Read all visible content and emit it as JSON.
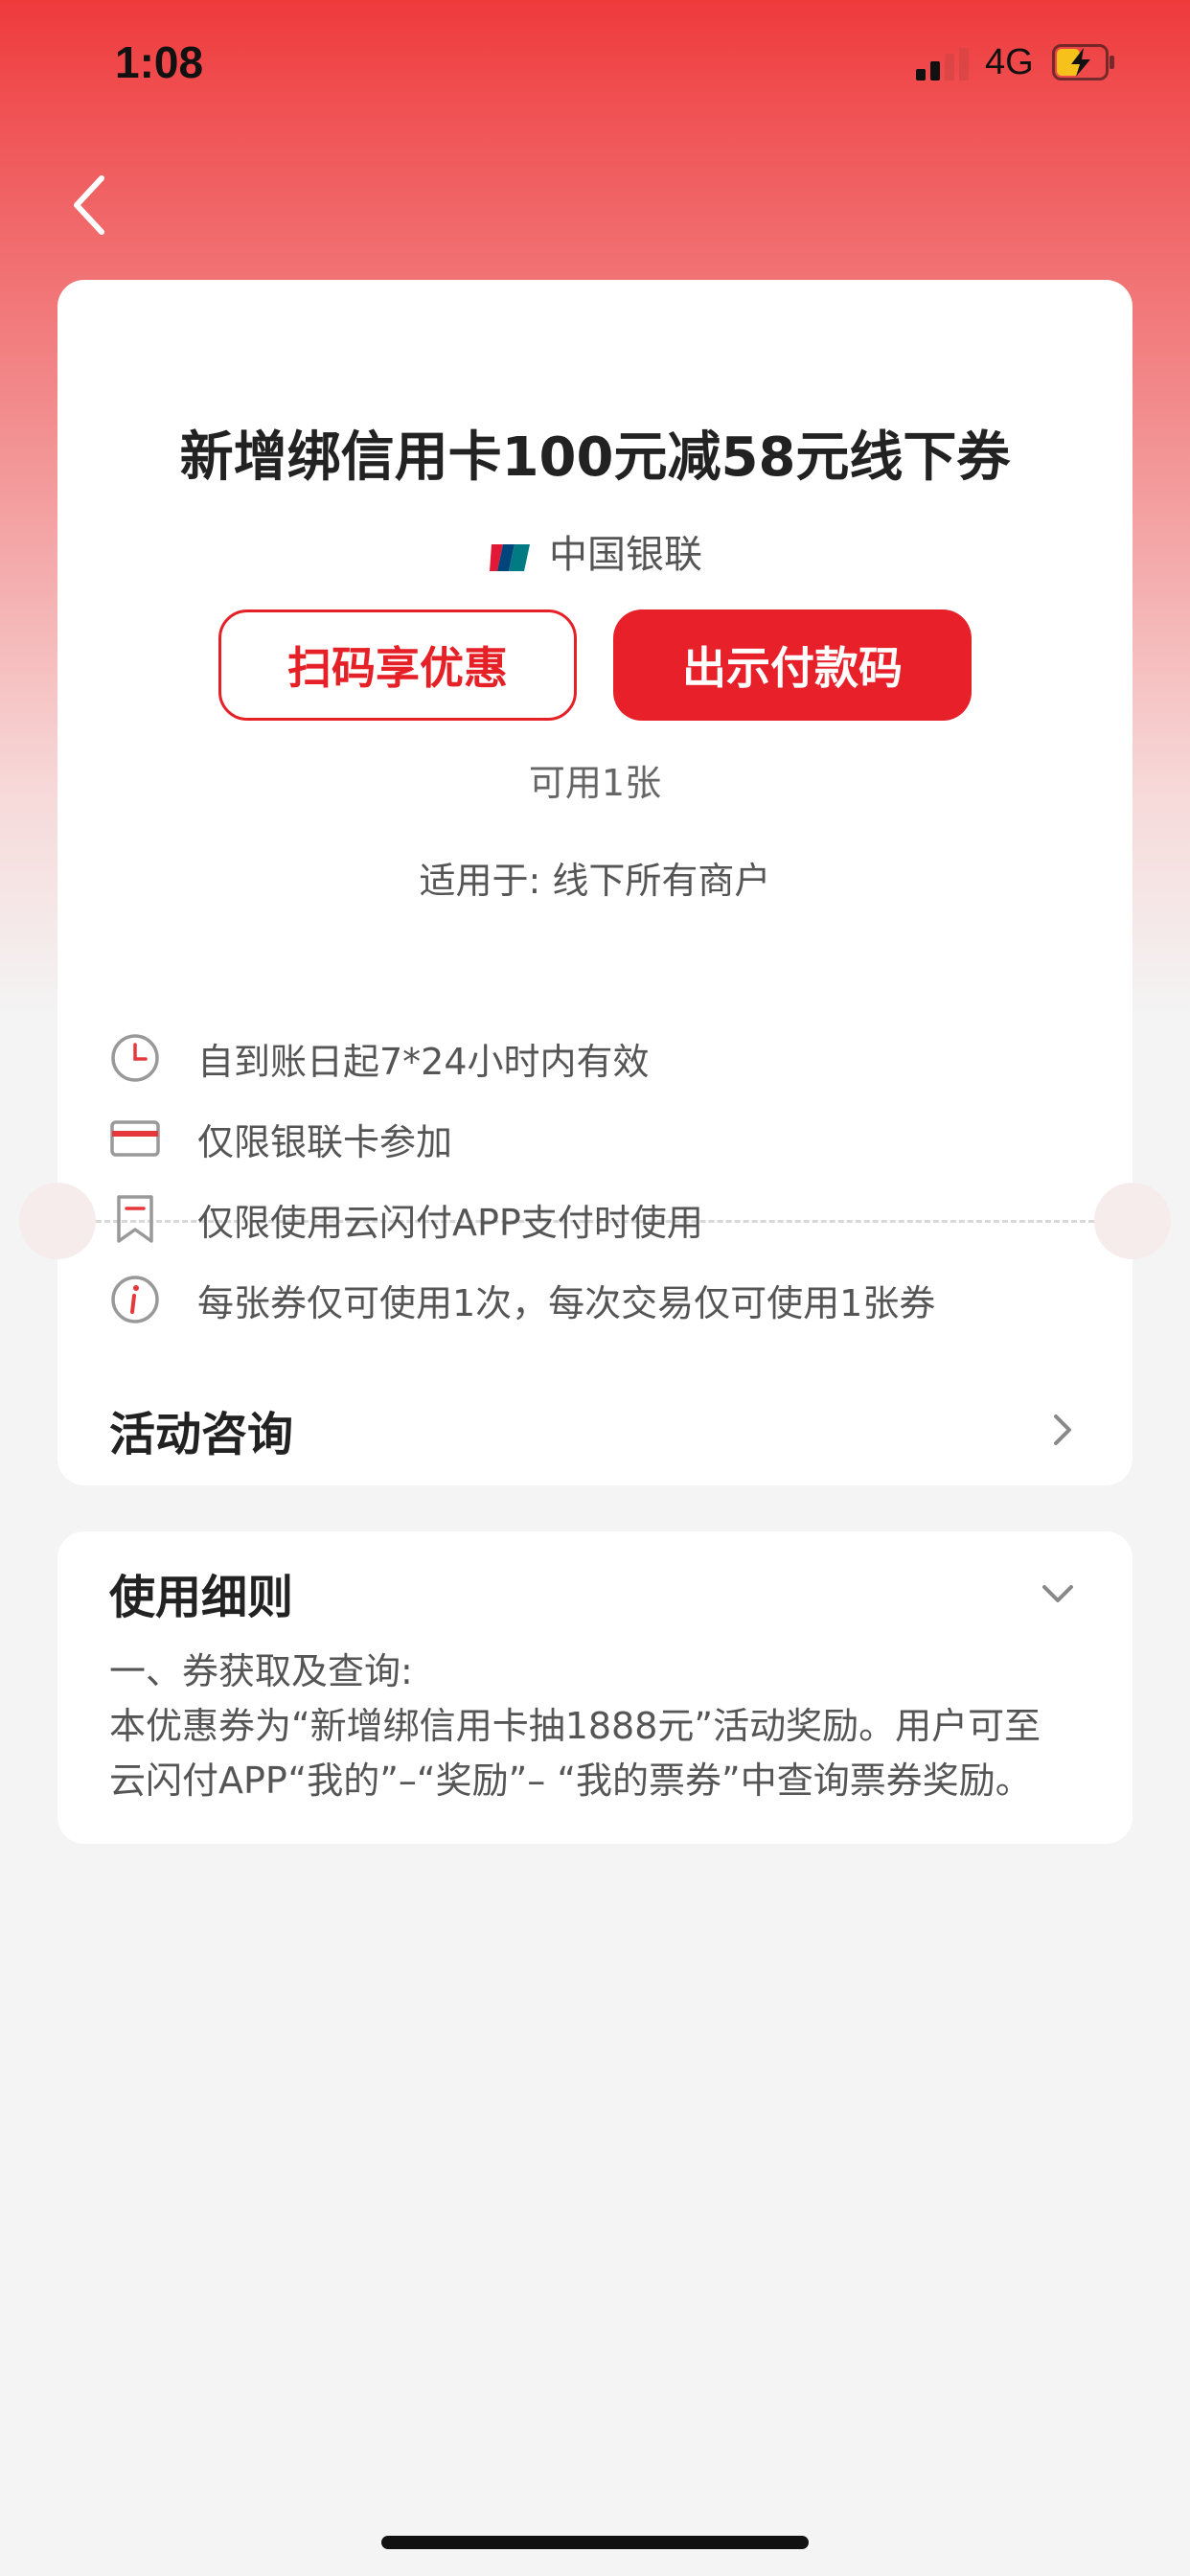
{
  "status_bar": {
    "time": "1:08",
    "network": "4G",
    "battery": "charging-battery-low"
  },
  "nav": {
    "back_icon": "chevron-left-icon"
  },
  "coupon": {
    "title": "新增绑信用卡100元减58元线下券",
    "brand": "中国银联",
    "brand_logo": "unionpay-logo",
    "scan_button": "扫码享优惠",
    "pay_button": "出示付款码",
    "available": "可用1张",
    "applies_to": "适用于: 线下所有商户"
  },
  "rules": [
    {
      "icon": "clock-icon",
      "text": "自到账日起7*24小时内有效"
    },
    {
      "icon": "card-icon",
      "text": "仅限银联卡参加"
    },
    {
      "icon": "bookmark-icon",
      "text": "仅限使用云闪付APP支付时使用"
    },
    {
      "icon": "info-icon",
      "text": "每张券仅可使用1次，每次交易仅可使用1张券"
    }
  ],
  "consult": {
    "label": "活动咨询",
    "icon": "chevron-right-icon"
  },
  "details": {
    "title": "使用细则",
    "icon": "chevron-down-icon",
    "heading": "一、券获取及查询:",
    "line1": "本优惠券为“新增绑信用卡抽1888元”活动奖励。用户可至",
    "line2": "云闪付APP“我的”–“奖励”– “我的票券”中查询票券奖励。"
  },
  "colors": {
    "accent": "#e7202a",
    "header_gradient_top": "#ef3a3c"
  }
}
